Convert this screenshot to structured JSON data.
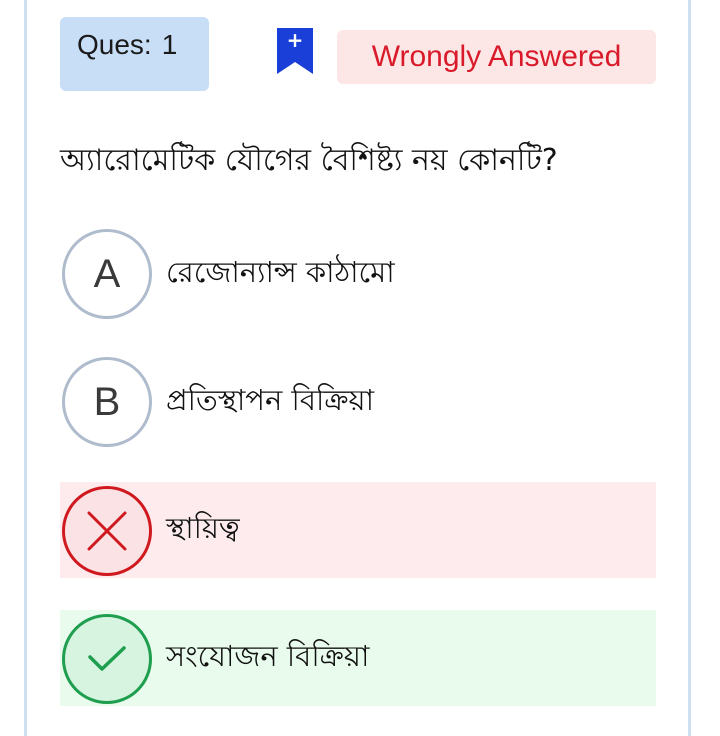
{
  "header": {
    "ques_label": "Ques:",
    "ques_number": "1",
    "status_text": "Wrongly Answered",
    "bookmark_glyph": "+"
  },
  "question": {
    "text": "অ্যারোমেটিক যৌগের বৈশিষ্ট্য নয় কোনটি?"
  },
  "options": [
    {
      "letter": "A",
      "text": "রেজোন্যান্স কাঠামো",
      "state": "normal"
    },
    {
      "letter": "B",
      "text": "প্রতিস্থাপন বিক্রিয়া",
      "state": "normal"
    },
    {
      "letter": "",
      "text": "স্থায়িত্ব",
      "state": "wrong",
      "icon": "cross-icon"
    },
    {
      "letter": "",
      "text": "সংযোজন বিক্রিয়া",
      "state": "correct",
      "icon": "check-icon"
    }
  ],
  "colors": {
    "ques_badge_bg": "#c8ddf6",
    "status_bg": "#fde6e6",
    "status_text": "#d91a2a",
    "bookmark": "#1a3ed8",
    "wrong": "#d0191f",
    "correct": "#1e9e4e"
  }
}
